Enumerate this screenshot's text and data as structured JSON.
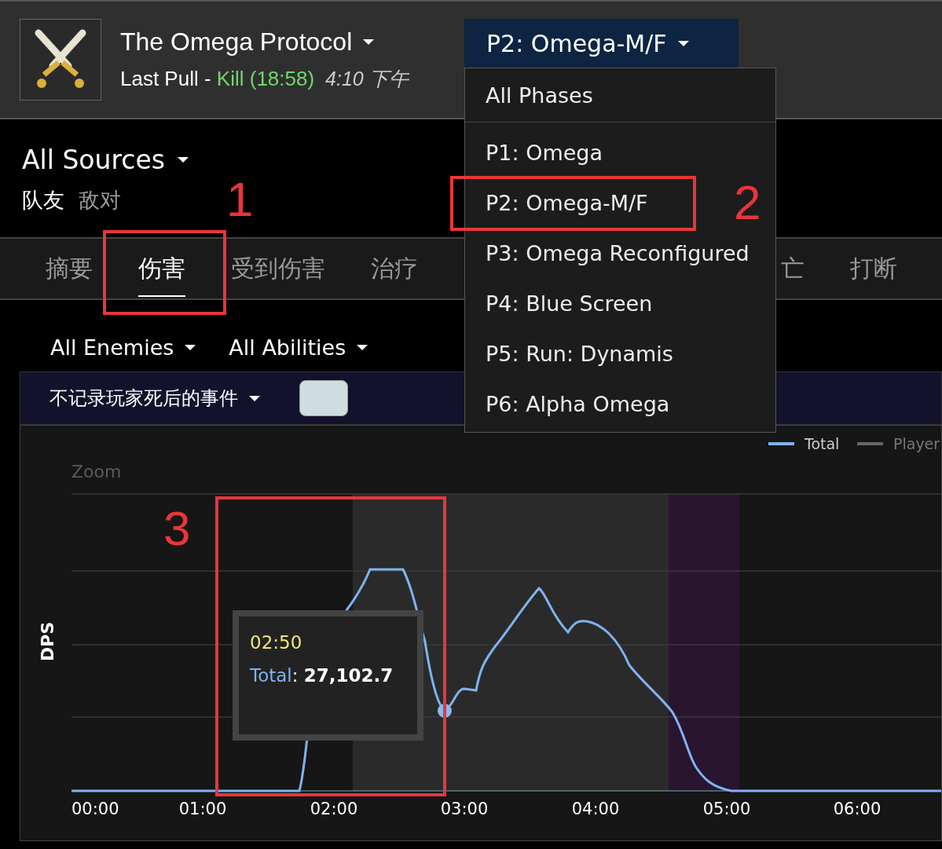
{
  "header": {
    "title": "The Omega Protocol",
    "subtitle": {
      "prefix": "Last Pull - ",
      "result": "Kill (18:58)",
      "time": "4:10 下午"
    }
  },
  "phase_selector": {
    "label": "P2: Omega-M/F",
    "expanded": true,
    "options": [
      {
        "label": "All Phases",
        "kind": "all"
      },
      {
        "label": "P1: Omega",
        "kind": "phase"
      },
      {
        "label": "P2: Omega-M/F",
        "kind": "phase"
      },
      {
        "label": "P3: Omega Reconfigured",
        "kind": "phase"
      },
      {
        "label": "P4: Blue Screen",
        "kind": "phase"
      },
      {
        "label": "P5: Run: Dynamis",
        "kind": "phase"
      },
      {
        "label": "P6: Alpha Omega",
        "kind": "phase"
      }
    ]
  },
  "sources": {
    "label": "All Sources",
    "filters": [
      {
        "label": "队友",
        "selected": true
      },
      {
        "label": "敌对",
        "selected": false
      }
    ]
  },
  "tabs": [
    {
      "label": "摘要",
      "selected": false
    },
    {
      "label": "伤害",
      "selected": true
    },
    {
      "label": "受到伤害",
      "selected": false
    },
    {
      "label": "治疗",
      "selected": false
    },
    {
      "label": "亡",
      "selected": false
    },
    {
      "label": "打断",
      "selected": false
    }
  ],
  "filters": [
    "All Enemies",
    "All Abilities"
  ],
  "options_bar": {
    "label": "不记录玩家死后的事件"
  },
  "chart": {
    "zoom_label": "Zoom",
    "ylabel": "DPS",
    "legend": [
      {
        "name": "Total",
        "color": "#7fb3f0"
      },
      {
        "name": "Player",
        "color": "#666666"
      }
    ],
    "xtick_labels": [
      "00:00",
      "01:00",
      "02:00",
      "03:00",
      "04:00",
      "05:00",
      "06:00"
    ],
    "tooltip": {
      "time": "02:50",
      "series": "Total",
      "separator": ":",
      "value": "27,102.7"
    }
  },
  "annotations": [
    "1",
    "2",
    "3"
  ]
}
